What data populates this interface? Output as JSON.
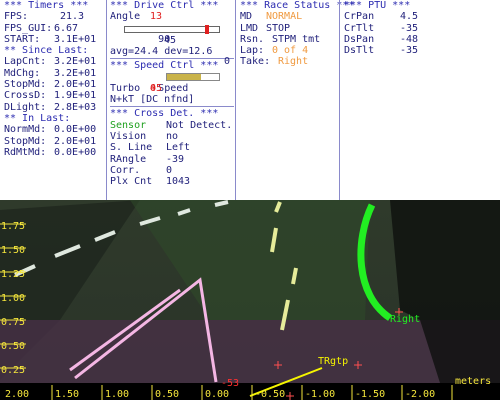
{
  "timers": {
    "title": "*** Timers ***",
    "fps_label": "FPS:",
    "fps_value": "21.3",
    "fpsgui_label": "FPS_GUI:",
    "fpsgui_value": "6.67",
    "start_label": "START:",
    "start_value": "3.1E+01",
    "since_title": "** Since Last:",
    "since": [
      {
        "label": "LapCnt:",
        "value": "3.2E+01"
      },
      {
        "label": "MdChg:",
        "value": "3.2E+01"
      },
      {
        "label": "StopMd:",
        "value": "2.0E+01"
      },
      {
        "label": "CrossD:",
        "value": "1.9E+01"
      },
      {
        "label": "DLight:",
        "value": "2.8E+03"
      }
    ],
    "in_title": "** In Last:",
    "in_last": [
      {
        "label": "NormMd:",
        "value": "0.0E+00"
      },
      {
        "label": "StopMd:",
        "value": "2.0E+01"
      },
      {
        "label": "RdMtMd:",
        "value": "0.0E+00"
      }
    ]
  },
  "drive": {
    "title": "*** Drive Ctrl ***",
    "angle_label": "Angle",
    "angle_value": "13",
    "slider_min": "90",
    "slider_max": "0",
    "slider_value_fraction": 0.87,
    "center_label": "45",
    "avg_text": "avg=24.4",
    "dev_text": "dev=12.6",
    "speed_title": "*** Speed Ctrl ***",
    "speed_label": "Speed",
    "speed_value": "45",
    "speed_fraction": 0.65,
    "turbo_label": "Turbo",
    "turbo_value": "0",
    "nkt_text": "N+kT [DC nfnd]",
    "cross_title": "*** Cross Det. ***",
    "cross": [
      {
        "label": "Sensor",
        "value": "Not Detect."
      },
      {
        "label": "Vision",
        "value": "no"
      },
      {
        "label": "S. Line",
        "value": "Left"
      },
      {
        "label": "RAngle",
        "value": "-39"
      },
      {
        "label": "Corr.",
        "value": "0"
      },
      {
        "label": "Plx Cnt",
        "value": "1043"
      }
    ]
  },
  "race": {
    "title": "*** Race Status ***",
    "md_label": "MD",
    "md_value": "NORMAL",
    "lmd_label": "LMD",
    "lmd_value": "STOP",
    "rsn_label": "Rsn.",
    "rsn_value": "STPM tmt",
    "lap_label": "Lap:",
    "lap_value": "0 of 4",
    "take_label": "Take:",
    "take_value": "Right"
  },
  "ptu": {
    "title": "*** PTU ***",
    "rows": [
      {
        "label": "CrPan",
        "value": "4.5"
      },
      {
        "label": "CrTlt",
        "value": "-35"
      },
      {
        "label": "DsPan",
        "value": "-48"
      },
      {
        "label": "DsTlt",
        "value": "-35"
      }
    ]
  },
  "camera": {
    "y_ticks": [
      "1.75",
      "1.50",
      "1.25",
      "1.00",
      "0.75",
      "0.50",
      "0.25"
    ],
    "x_ticks": [
      "2.00",
      "1.50",
      "1.00",
      "0.50",
      "0.00",
      "-0.50",
      "-1.00",
      "-1.50",
      "-2.00"
    ],
    "x_unit": "meters",
    "marker_label": "-53",
    "target_label": "TRgtp",
    "right_label": "Right",
    "colors": {
      "axis_text": "#f5e63c",
      "green_line": "#22ee22",
      "pink_line": "#f4b6e4",
      "target_line": "#f5f500",
      "marker": "#ff3030"
    }
  }
}
